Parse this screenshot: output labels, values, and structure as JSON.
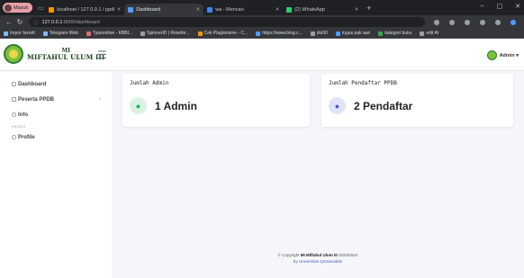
{
  "browser": {
    "profile_label": "Masuk",
    "tabs": [
      {
        "label": "localhost / 127.0.0.1 / ppdb | php",
        "active": false,
        "favicon_color": "#f29900"
      },
      {
        "label": "Dashboard",
        "active": true,
        "favicon_color": "#4f9cff"
      },
      {
        "label": "wa - Mencari",
        "active": false,
        "favicon_color": "#4285f4"
      },
      {
        "label": "(2) WhatsApp",
        "active": false,
        "favicon_color": "#25d366"
      }
    ],
    "new_tab_symbol": "+",
    "window_controls": [
      "–",
      "▢",
      "✕"
    ],
    "url_host": "127.0.0.1",
    "url_path": ":8000/dashboard",
    "bookmarks": [
      "Impor favorit",
      "Telegram Web",
      "Typeonline - KBBI...",
      "SpinnerID | Rewrite...",
      "Cek Plagiarisme - C...",
      "https://www.bing.c...",
      "doi00",
      "tugas pak aan",
      "kategori buku",
      "edit AI"
    ]
  },
  "app": {
    "brand_line1": "MI",
    "brand_line2": "MIFTAHUL ULUM III",
    "admin_label": "Admin",
    "sidebar": {
      "items": [
        {
          "label": "Dashboard",
          "icon": "dashboard-icon"
        },
        {
          "label": "Peserta PPDB",
          "icon": "people-icon",
          "chevron": "‹"
        },
        {
          "label": "Info",
          "icon": "info-icon"
        }
      ],
      "section_label": "PAGES",
      "pages": [
        {
          "label": "Profile",
          "icon": "user-icon"
        }
      ]
    },
    "cards": [
      {
        "title": "Jumlah Admin",
        "value": "1 Admin",
        "icon": "user-icon",
        "glyph": "👤"
      },
      {
        "title": "Jumlah Pendaftar PPDB",
        "value": "2 Pendaftar",
        "icon": "user-check-icon",
        "glyph": "👥"
      }
    ],
    "footer": {
      "copyright_prefix": "© Copyright",
      "copyright_name": "MI Miftahul Ulum III",
      "copyright_year": "2023/2024",
      "by_line": "by Universitas Qomaruddin"
    }
  },
  "colors": {
    "brand_green": "#7cc03a",
    "admin_icon_bg": "#d8f3e2",
    "admin_icon_fg": "#1bb55c",
    "pendaftar_icon_bg": "#e0e3f7",
    "pendaftar_icon_fg": "#4b57c5"
  }
}
